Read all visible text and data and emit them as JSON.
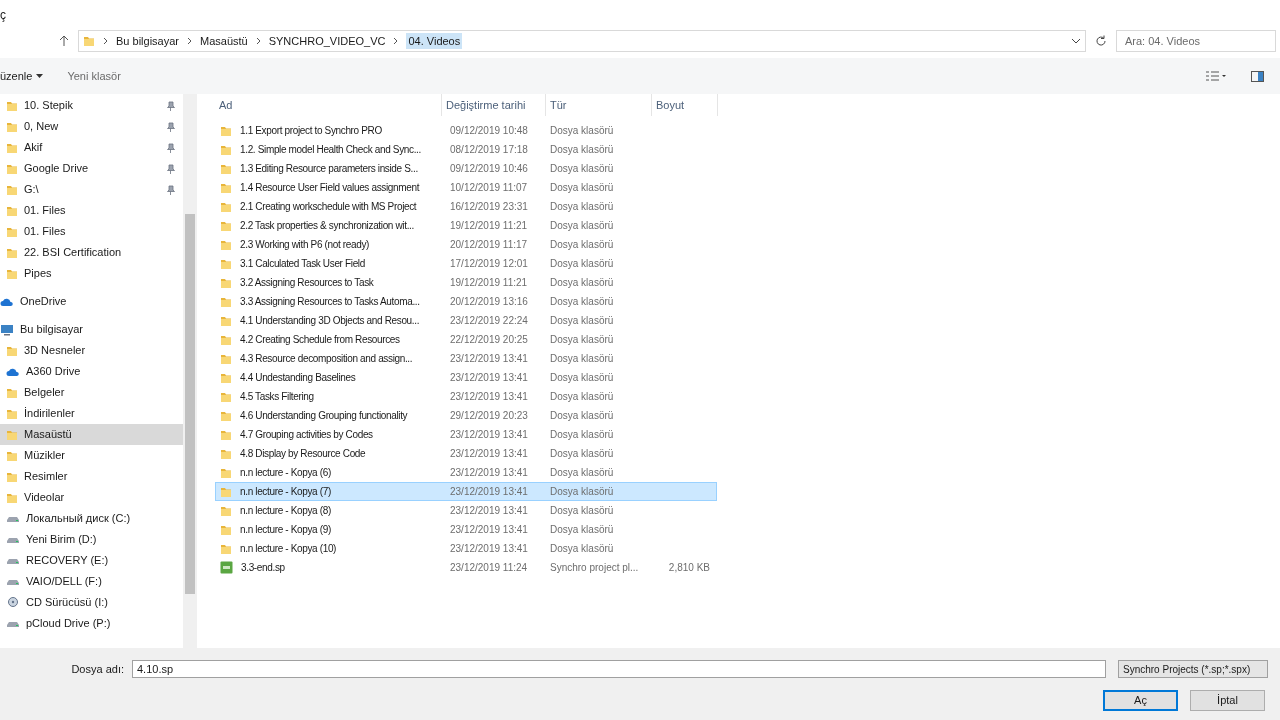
{
  "window": {
    "title": "ç"
  },
  "address_bar": {
    "path": [
      "Bu bilgisayar",
      "Masaüstü",
      "SYNCHRO_VIDEO_VC",
      "04. Videos"
    ]
  },
  "search": {
    "placeholder": "Ara: 04. Videos"
  },
  "toolbar": {
    "organize": "üzenle",
    "new_folder": "Yeni klasör"
  },
  "sidebar": {
    "quick_access": [
      {
        "label": "10. Stepik",
        "pinned": true,
        "selected": false
      },
      {
        "label": "0, New",
        "pinned": true,
        "selected": false
      },
      {
        "label": "Akif",
        "pinned": true,
        "selected": false
      },
      {
        "label": "Google Drive",
        "pinned": true,
        "selected": false
      },
      {
        "label": "G:\\",
        "pinned": true,
        "selected": false
      },
      {
        "label": "01. Files",
        "pinned": false,
        "selected": false
      },
      {
        "label": "01. Files",
        "pinned": false,
        "selected": false
      },
      {
        "label": "22. BSI Certification",
        "pinned": false,
        "selected": false
      },
      {
        "label": "Pipes",
        "pinned": false,
        "selected": false
      }
    ],
    "roots": [
      {
        "label": "OneDrive",
        "kind": "cloud",
        "selected": false
      },
      {
        "label": "Bu bilgisayar",
        "kind": "computer",
        "selected": false,
        "children": [
          {
            "label": "3D Nesneler",
            "kind": "folder",
            "selected": false
          },
          {
            "label": "A360 Drive",
            "kind": "cloud",
            "selected": false
          },
          {
            "label": "Belgeler",
            "kind": "folder",
            "selected": false
          },
          {
            "label": "İndirilenler",
            "kind": "folder",
            "selected": false
          },
          {
            "label": "Masaüstü",
            "kind": "folder",
            "selected": true
          },
          {
            "label": "Müzikler",
            "kind": "folder",
            "selected": false
          },
          {
            "label": "Resimler",
            "kind": "folder",
            "selected": false
          },
          {
            "label": "Videolar",
            "kind": "folder",
            "selected": false
          },
          {
            "label": "Локальный диск (C:)",
            "kind": "drive",
            "selected": false
          },
          {
            "label": "Yeni Birim (D:)",
            "kind": "drive",
            "selected": false
          },
          {
            "label": "RECOVERY (E:)",
            "kind": "drive",
            "selected": false
          },
          {
            "label": "VAIO/DELL (F:)",
            "kind": "drive",
            "selected": false
          },
          {
            "label": "CD Sürücüsü (I:)",
            "kind": "disc",
            "selected": false
          },
          {
            "label": "pCloud Drive (P:)",
            "kind": "drive",
            "selected": false
          }
        ]
      }
    ]
  },
  "table": {
    "columns": [
      "Ad",
      "Değiştirme tarihi",
      "Tür",
      "Boyut"
    ],
    "rows": [
      {
        "kind": "folder",
        "name": "1.1 Export project to Synchro PRO",
        "date": "09/12/2019 10:48",
        "type": "Dosya klasörü",
        "selected": false
      },
      {
        "kind": "folder",
        "name": "1.2. Simple model Health Check and Sync...",
        "date": "08/12/2019 17:18",
        "type": "Dosya klasörü",
        "selected": false
      },
      {
        "kind": "folder",
        "name": "1.3 Editing Resource parameters inside S...",
        "date": "09/12/2019 10:46",
        "type": "Dosya klasörü",
        "selected": false
      },
      {
        "kind": "folder",
        "name": "1.4 Resource User Field values assignment",
        "date": "10/12/2019 11:07",
        "type": "Dosya klasörü",
        "selected": false
      },
      {
        "kind": "folder",
        "name": "2.1 Creating workschedule with MS Project",
        "date": "16/12/2019 23:31",
        "type": "Dosya klasörü",
        "selected": false
      },
      {
        "kind": "folder",
        "name": "2.2 Task properties & synchronization wit...",
        "date": "19/12/2019 11:21",
        "type": "Dosya klasörü",
        "selected": false
      },
      {
        "kind": "folder",
        "name": "2.3 Working with P6 (not ready)",
        "date": "20/12/2019 11:17",
        "type": "Dosya klasörü",
        "selected": false
      },
      {
        "kind": "folder",
        "name": "3.1 Calculated Task User Field",
        "date": "17/12/2019 12:01",
        "type": "Dosya klasörü",
        "selected": false
      },
      {
        "kind": "folder",
        "name": "3.2 Assigning Resources to Task",
        "date": "19/12/2019 11:21",
        "type": "Dosya klasörü",
        "selected": false
      },
      {
        "kind": "folder",
        "name": "3.3 Assigning Resources to Tasks Automa...",
        "date": "20/12/2019 13:16",
        "type": "Dosya klasörü",
        "selected": false
      },
      {
        "kind": "folder",
        "name": "4.1 Understanding 3D Objects and Resou...",
        "date": "23/12/2019 22:24",
        "type": "Dosya klasörü",
        "selected": false
      },
      {
        "kind": "folder",
        "name": "4.2 Creating Schedule from Resources",
        "date": "22/12/2019 20:25",
        "type": "Dosya klasörü",
        "selected": false
      },
      {
        "kind": "folder",
        "name": "4.3 Resource decomposition and assign...",
        "date": "23/12/2019 13:41",
        "type": "Dosya klasörü",
        "selected": false
      },
      {
        "kind": "folder",
        "name": "4.4 Undestanding Baselines",
        "date": "23/12/2019 13:41",
        "type": "Dosya klasörü",
        "selected": false
      },
      {
        "kind": "folder",
        "name": "4.5 Tasks Filtering",
        "date": "23/12/2019 13:41",
        "type": "Dosya klasörü",
        "selected": false
      },
      {
        "kind": "folder",
        "name": "4.6 Understanding Grouping functionality",
        "date": "29/12/2019 20:23",
        "type": "Dosya klasörü",
        "selected": false
      },
      {
        "kind": "folder",
        "name": "4.7 Grouping activities by Codes",
        "date": "23/12/2019 13:41",
        "type": "Dosya klasörü",
        "selected": false
      },
      {
        "kind": "folder",
        "name": "4.8 Display by Resource Code",
        "date": "23/12/2019 13:41",
        "type": "Dosya klasörü",
        "selected": false
      },
      {
        "kind": "folder",
        "name": "n.n lecture - Kopya (6)",
        "date": "23/12/2019 13:41",
        "type": "Dosya klasörü",
        "selected": false
      },
      {
        "kind": "folder",
        "name": "n.n lecture - Kopya (7)",
        "date": "23/12/2019 13:41",
        "type": "Dosya klasörü",
        "selected": true
      },
      {
        "kind": "folder",
        "name": "n.n lecture - Kopya (8)",
        "date": "23/12/2019 13:41",
        "type": "Dosya klasörü",
        "selected": false
      },
      {
        "kind": "folder",
        "name": "n.n lecture - Kopya (9)",
        "date": "23/12/2019 13:41",
        "type": "Dosya klasörü",
        "selected": false
      },
      {
        "kind": "folder",
        "name": "n.n lecture - Kopya (10)",
        "date": "23/12/2019 13:41",
        "type": "Dosya klasörü",
        "selected": false
      },
      {
        "kind": "file",
        "name": "3.3-end.sp",
        "date": "23/12/2019 11:24",
        "type": "Synchro project pl...",
        "size": "2,810 KB",
        "selected": false
      }
    ]
  },
  "footer": {
    "filename_label": "Dosya adı:",
    "filename": "4.10.sp",
    "filter": "Synchro Projects (*.sp;*.spx)",
    "buttons": [
      {
        "label": "Aç",
        "default": true
      },
      {
        "label": "İptal",
        "default": false
      }
    ]
  }
}
